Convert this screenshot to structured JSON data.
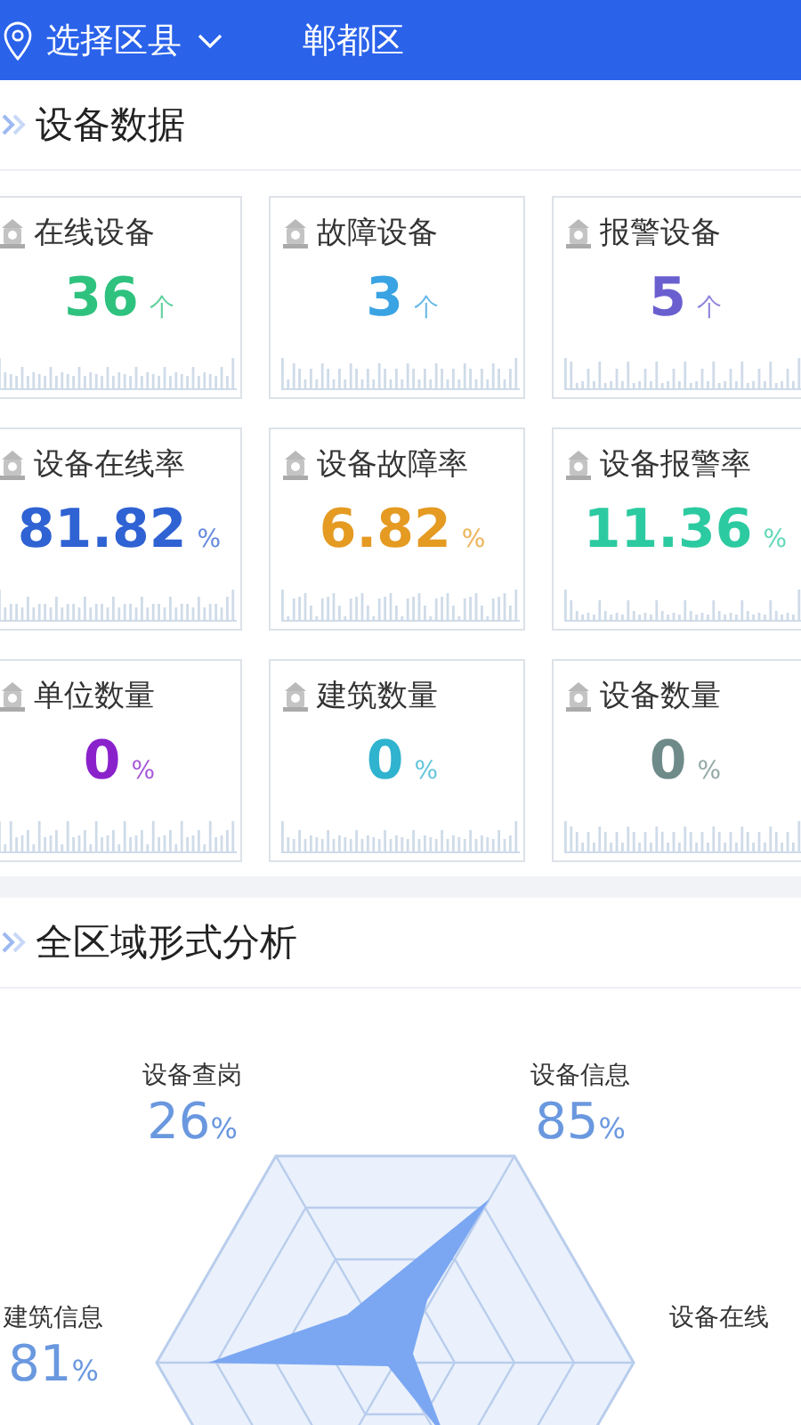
{
  "header": {
    "district_selector": "选择区县",
    "district": "郸都区"
  },
  "device_section": {
    "title": "设备数据",
    "cards": [
      {
        "title": "在线设备",
        "value": "36",
        "unit": "个",
        "color": "#2ec27e"
      },
      {
        "title": "故障设备",
        "value": "3",
        "unit": "个",
        "color": "#3aa3e3"
      },
      {
        "title": "报警设备",
        "value": "5",
        "unit": "个",
        "color": "#6a5fcf"
      },
      {
        "title": "设备在线率",
        "value": "81.82",
        "unit": "%",
        "color": "#2f62d3"
      },
      {
        "title": "设备故障率",
        "value": "6.82",
        "unit": "%",
        "color": "#e59a22"
      },
      {
        "title": "设备报警率",
        "value": "11.36",
        "unit": "%",
        "color": "#2ccaa0"
      },
      {
        "title": "单位数量",
        "value": "0",
        "unit": "%",
        "color": "#8a22cc"
      },
      {
        "title": "建筑数量",
        "value": "0",
        "unit": "%",
        "color": "#2fb3cf"
      },
      {
        "title": "设备数量",
        "value": "0",
        "unit": "%",
        "color": "#6f8b89"
      }
    ]
  },
  "analysis_section": {
    "title": "全区域形式分析",
    "radar_labels": [
      {
        "label": "设备查岗",
        "value": "26",
        "unit": "%"
      },
      {
        "label": "设备信息",
        "value": "85",
        "unit": "%"
      },
      {
        "label": "建筑信息",
        "value": "81",
        "unit": "%"
      },
      {
        "label": "设备在线"
      }
    ]
  }
}
